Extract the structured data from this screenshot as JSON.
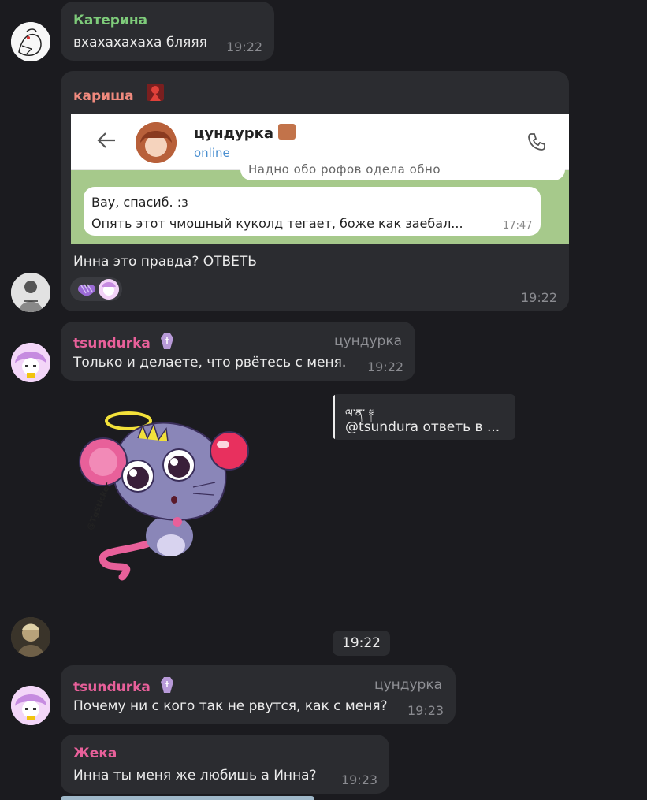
{
  "messages": [
    {
      "sender": "Катерина",
      "text": "вхахахахаха бляяя",
      "time": "19:22",
      "sender_color": "#7ecb7a"
    },
    {
      "sender": "кариша",
      "text": "Инна это правда? ОТВЕТЬ",
      "time": "19:22",
      "sender_color": "#f08a7e",
      "embedded": {
        "contact_name": "цундурка",
        "status": "online",
        "quote_line1": "Вау, спасиб. :з",
        "quote_line2": "Опять этот чмошный куколд тегает, боже как заебал...",
        "quote_time": "17:47",
        "partial_line": "Надно обо рофов одела обно"
      }
    },
    {
      "sender": "tsundurka",
      "role": "цундурка",
      "text": "Только и делаете, что рвётесь с меня.",
      "time": "19:22",
      "sender_color": "#e8609a"
    },
    {
      "sender": "tsundurka",
      "role": "цундурка",
      "text": "Почему ни с кого так не рвутся, как с меня?",
      "time": "19:23",
      "sender_color": "#e8609a"
    },
    {
      "sender": "Жека",
      "text": "Инна ты меня же любишь а Инна?",
      "time": "19:23",
      "sender_color": "#e8609a"
    }
  ],
  "reply_card": {
    "title": "ལ་ན་ ༈",
    "text": "@tsundura ответь в ..."
  },
  "sticker": {
    "watermark": "@TgSticker",
    "time": "19:22"
  },
  "colors": {
    "background": "#1b1b1f",
    "bubble": "#2b2c30",
    "accent_purple": "#9b6bd6"
  }
}
